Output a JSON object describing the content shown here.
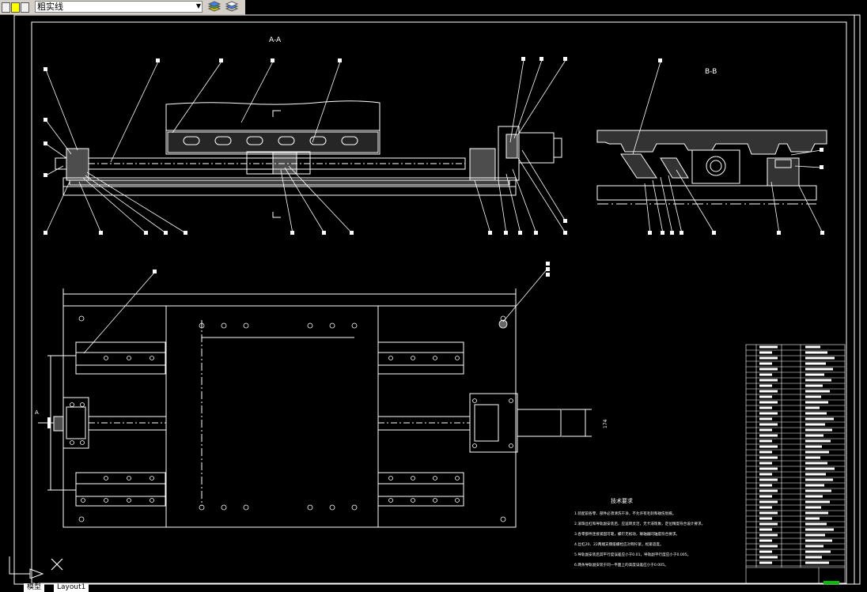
{
  "toolbar": {
    "layer_current": "粗实线",
    "icons": [
      "lightbulb-icon",
      "sun-icon",
      "lock-icon",
      "layer-color-icon",
      "layer-states-icon",
      "layer-previous-icon"
    ]
  },
  "drawing": {
    "section_aa_title": "A-A",
    "section_bb_title": "B-B",
    "section_marker_a": "A",
    "dim_174": "174",
    "tech_requirements_title": "技术要求",
    "tech_requirements": [
      "1.装配前各零、部件必须清洗干净，不允许有毛刺和碰伤划痕。",
      "2.滚珠丝杠和导轨副安装后，应运转灵活，无卡滞现象，定位精度符合设计要求。",
      "3.各零部件连接紧固可靠，螺钉无松动，联轴器同轴度符合要求。",
      "4.丝杠20、22两端支撑座螺栓应对称拧紧，松紧适度。",
      "5.导轨副安装后其平行度误差应小于0.01，导轨副平行度应小于0.005。",
      "6.两条导轨副安装于同一平面上的高度误差应小于0.005。"
    ]
  },
  "tabs": {
    "model": "模型",
    "layout": "Layout1"
  },
  "colors": {
    "background": "#000000",
    "lines": "#ffffff",
    "toolbar": "#d4d0c8",
    "title_block_accent": "#00c000"
  }
}
